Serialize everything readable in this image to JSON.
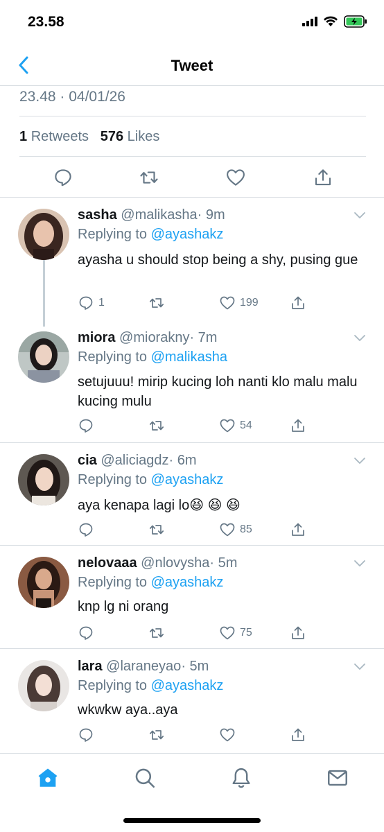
{
  "status_bar": {
    "time": "23.58"
  },
  "nav": {
    "title": "Tweet"
  },
  "tweet": {
    "timestamp": "23.48 · 04/01/26",
    "retweets_count": "1",
    "retweets_label": "Retweets",
    "likes_count": "576",
    "likes_label": "Likes"
  },
  "replies": [
    {
      "name": "sasha",
      "handle": "@malikasha",
      "time": "· 9m",
      "replying_prefix": "Replying to",
      "replying_to": "@ayashakz",
      "text": "ayasha u should stop being a shy, pusing gue",
      "reply_count": "1",
      "like_count": "199"
    },
    {
      "name": "miora",
      "handle": "@miorakny",
      "time": "· 7m",
      "replying_prefix": "Replying to",
      "replying_to": "@malikasha",
      "text": "setujuuu! mirip kucing loh nanti klo malu malu kucing mulu",
      "reply_count": "",
      "like_count": "54"
    },
    {
      "name": "cia",
      "handle": "@aliciagdz",
      "time": "· 6m",
      "replying_prefix": "Replying to",
      "replying_to": "@ayashakz",
      "text": "aya kenapa lagi lo😆 😆 😆",
      "reply_count": "",
      "like_count": "85"
    },
    {
      "name": "nelovaaa",
      "handle": "@nlovysha",
      "time": "· 5m",
      "replying_prefix": "Replying to",
      "replying_to": "@ayashakz",
      "text": "knp lg ni orang",
      "reply_count": "",
      "like_count": "75"
    },
    {
      "name": "lara",
      "handle": "@laraneyao",
      "time": "· 5m",
      "replying_prefix": "Replying to",
      "replying_to": "@ayashakz",
      "text": "wkwkw aya..aya",
      "reply_count": "",
      "like_count": ""
    }
  ],
  "icons": {
    "accent": "#1da1f2",
    "gray": "#657786"
  }
}
